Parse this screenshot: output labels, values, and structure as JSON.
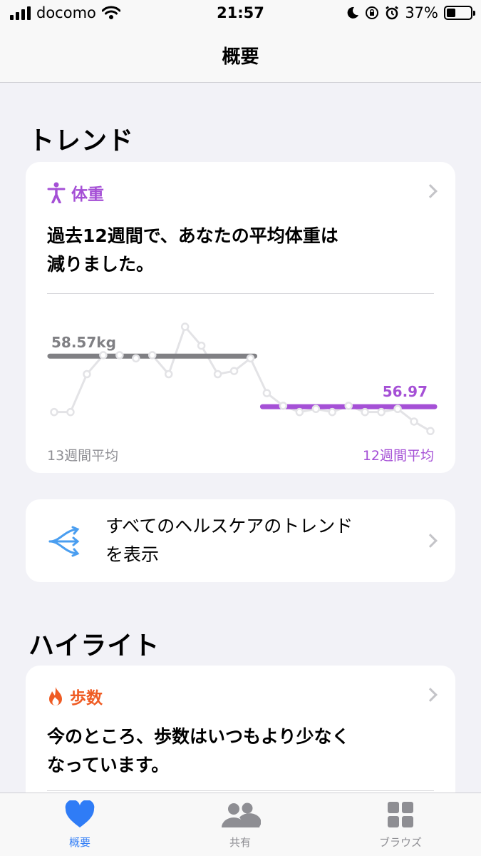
{
  "status_bar": {
    "carrier": "docomo",
    "time": "21:57",
    "battery": "37%",
    "battery_level": 0.37
  },
  "nav": {
    "title": "概要"
  },
  "trends": {
    "section_title": "トレンド",
    "weight_card": {
      "category": "体重",
      "message_line1": "過去12週間で、あなたの平均体重は",
      "message_line2": "減りました。",
      "old_avg_label": "58.57kg",
      "new_avg_label": "56.97",
      "left_caption": "13週間平均",
      "right_caption": "12週間平均",
      "colors": {
        "accent": "#a550d6",
        "old_line": "#808084",
        "points": "#e3e3e6"
      }
    },
    "all_trends_card": {
      "line1": "すべてのヘルスケアのトレンド",
      "line2": "を表示"
    }
  },
  "highlights": {
    "section_title": "ハイライト",
    "steps_card": {
      "category": "歩数",
      "message_line1": "今のところ、歩数はいつもより少なく",
      "message_line2": "なっています。",
      "color": "#ef5b23"
    }
  },
  "tab_bar": {
    "items": [
      {
        "label": "概要",
        "active": true
      },
      {
        "label": "共有",
        "active": false
      },
      {
        "label": "ブラウズ",
        "active": false
      }
    ],
    "active_color": "#2f7cf6",
    "inactive_color": "#8e8e93"
  },
  "chart_data": {
    "type": "line",
    "series": [
      {
        "values": [
          56.8,
          56.8,
          58.0,
          58.6,
          58.6,
          58.5,
          58.6,
          58.0,
          59.5,
          58.9,
          58.0,
          58.1,
          58.5,
          57.4,
          57.0,
          56.8,
          56.9,
          56.8,
          57.0,
          56.8,
          56.8,
          56.9,
          56.5,
          56.2
        ]
      }
    ],
    "averages": [
      {
        "label": "58.57kg",
        "value": 58.57,
        "range": [
          0,
          12
        ]
      },
      {
        "label": "56.97",
        "value": 56.97,
        "range": [
          13,
          23
        ]
      }
    ],
    "ylim": [
      55.8,
      60.2
    ]
  }
}
